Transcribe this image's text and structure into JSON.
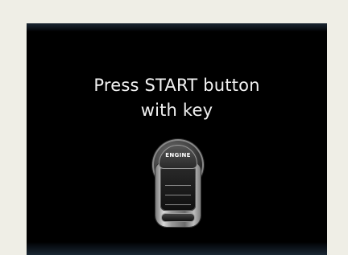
{
  "screen": {
    "message_line1": "Press START button",
    "message_line2": "with key",
    "fob_button_label": "ENGINE",
    "icon": "key-fob-icon"
  }
}
